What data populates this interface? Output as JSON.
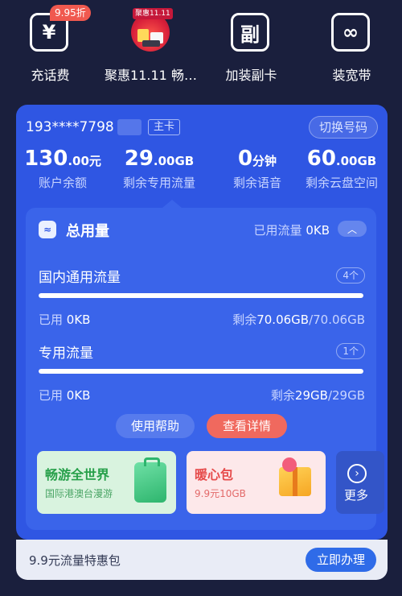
{
  "quick_actions": [
    {
      "label": "充话费",
      "icon": "yuan-icon",
      "glyph": "¥",
      "badge": "9.95折"
    },
    {
      "label": "聚惠11.11 畅…",
      "icon": "promo-image",
      "badge": "聚惠11.11"
    },
    {
      "label": "加装副卡",
      "icon": "secondary-card-icon",
      "glyph": "副"
    },
    {
      "label": "装宽带",
      "icon": "broadband-router-icon",
      "glyph": "∞"
    }
  ],
  "account": {
    "phone": "193****7798",
    "tag": "主卡",
    "switch_label": "切换号码"
  },
  "stats": [
    {
      "value": "130",
      "unit": ".00元",
      "label": "账户余额"
    },
    {
      "value": "29",
      "unit": ".00GB",
      "label": "剩余专用流量"
    },
    {
      "value": "0",
      "unit": "分钟",
      "label": "剩余语音"
    },
    {
      "value": "60",
      "unit": ".00GB",
      "label": "剩余云盘空间"
    }
  ],
  "usage": {
    "title": "总用量",
    "used_label": "已用流量",
    "used_value": "0KB",
    "sections": [
      {
        "title": "国内通用流量",
        "count": "4个",
        "used_label": "已用",
        "used_value": "0KB",
        "remain_label": "剩余",
        "remain_value": "70.06GB",
        "total": "/70.06GB",
        "remaining_fraction": 1.0
      },
      {
        "title": "专用流量",
        "count": "1个",
        "used_label": "已用",
        "used_value": "0KB",
        "remain_label": "剩余",
        "remain_value": "29GB",
        "total": "/29GB",
        "remaining_fraction": 1.0
      }
    ],
    "help_label": "使用帮助",
    "detail_label": "查看详情"
  },
  "packages": [
    {
      "title": "畅游全世界",
      "subtitle": "国际港澳台漫游"
    },
    {
      "title": "暖心包",
      "subtitle": "9.9元10GB"
    }
  ],
  "more_label": "更多",
  "offer": {
    "text": "9.9元流量特惠包",
    "button": "立即办理"
  },
  "colors": {
    "background": "#1a1f3d",
    "card_blue": "#2f56e3",
    "accent_red": "#f0695e",
    "button_blue": "#2f6be8"
  }
}
